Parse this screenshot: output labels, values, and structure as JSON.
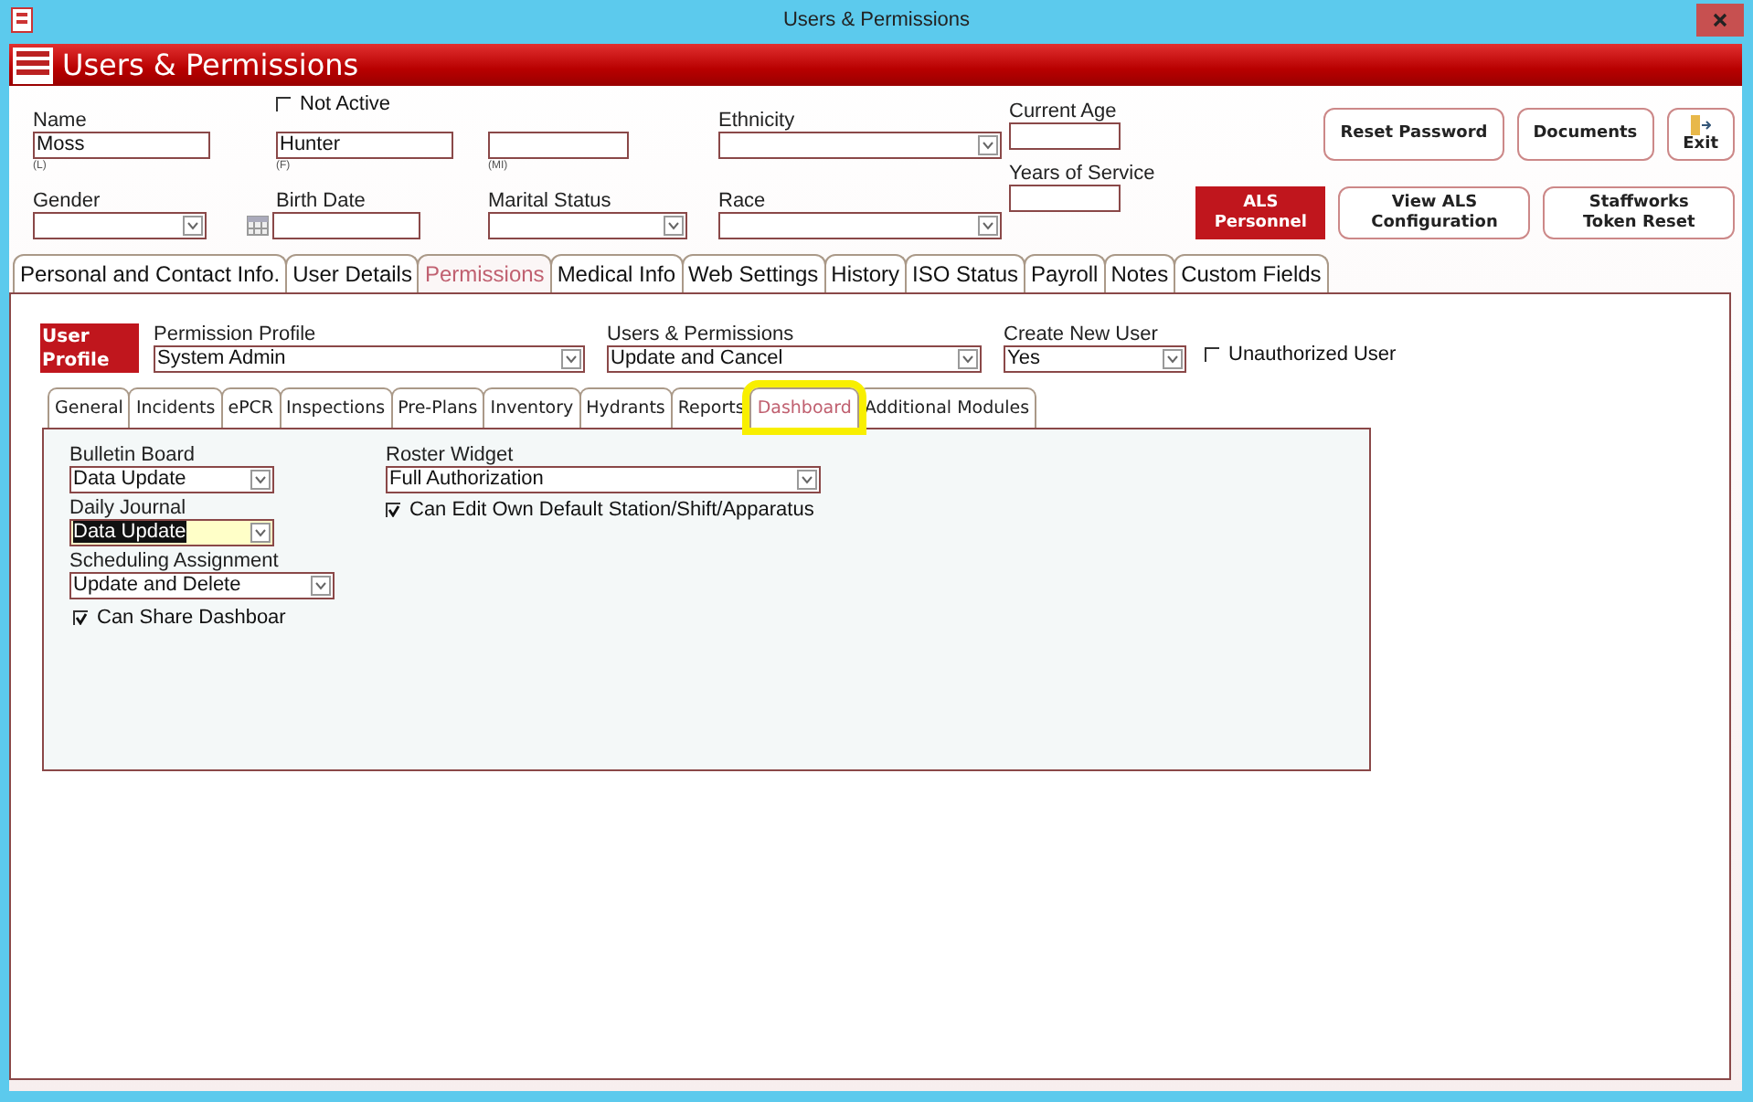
{
  "window": {
    "title": "Users & Permissions"
  },
  "header": {
    "title": "Users & Permissions"
  },
  "not_active": {
    "label": "Not Active",
    "checked": false
  },
  "name": {
    "label": "Name",
    "last": {
      "value": "Moss",
      "hint": "(L)"
    },
    "first": {
      "value": "Hunter",
      "hint": "(F)"
    },
    "middle": {
      "hint": "(MI)"
    }
  },
  "ethnicity": {
    "label": "Ethnicity"
  },
  "current_age": {
    "label": "Current Age"
  },
  "gender": {
    "label": "Gender"
  },
  "birth_date": {
    "label": "Birth Date"
  },
  "marital_status": {
    "label": "Marital Status"
  },
  "race": {
    "label": "Race"
  },
  "years_of_service": {
    "label": "Years of Service"
  },
  "top_buttons": [
    {
      "label": "Reset Password",
      "kind": "plain"
    },
    {
      "label": "Documents",
      "kind": "plain"
    },
    {
      "label": "Exit",
      "kind": "exit"
    }
  ],
  "bottom_buttons": [
    {
      "label": "ALS Personnel",
      "kind": "red"
    },
    {
      "label": "View ALS Configuration",
      "kind": "plain"
    },
    {
      "label": "Staffworks Token Reset",
      "kind": "plain"
    }
  ],
  "tabs": [
    {
      "label": "Personal and Contact Info.",
      "selected": false
    },
    {
      "label": "User Details",
      "selected": false
    },
    {
      "label": "Permissions",
      "selected": true
    },
    {
      "label": "Medical Info",
      "selected": false
    },
    {
      "label": "Web Settings",
      "selected": false
    },
    {
      "label": "History",
      "selected": false
    },
    {
      "label": "ISO Status",
      "selected": false
    },
    {
      "label": "Payroll",
      "selected": false
    },
    {
      "label": "Notes",
      "selected": false
    },
    {
      "label": "Custom Fields",
      "selected": false
    }
  ],
  "permissions": {
    "badge": "User Profile",
    "fields": [
      {
        "label": "Permission Profile",
        "value": "System Admin"
      },
      {
        "label": "Users & Permissions",
        "value": "Update and Cancel"
      },
      {
        "label": "Create New User",
        "value": "Yes"
      }
    ],
    "unauthorized": {
      "label": "Unauthorized User",
      "checked": false
    }
  },
  "subtabs": [
    {
      "label": "General",
      "selected": false,
      "highlighted": false
    },
    {
      "label": "Incidents",
      "selected": false,
      "highlighted": false
    },
    {
      "label": "ePCR",
      "selected": false,
      "highlighted": false
    },
    {
      "label": "Inspections",
      "selected": false,
      "highlighted": false
    },
    {
      "label": "Pre-Plans",
      "selected": false,
      "highlighted": false
    },
    {
      "label": "Inventory",
      "selected": false,
      "highlighted": false
    },
    {
      "label": "Hydrants",
      "selected": false,
      "highlighted": false
    },
    {
      "label": "Reports",
      "selected": false,
      "highlighted": false
    },
    {
      "label": "Dashboard",
      "selected": true,
      "highlighted": true
    },
    {
      "label": "Additional Modules",
      "selected": false,
      "highlighted": false
    }
  ],
  "dashboard": {
    "left": [
      {
        "label": "Bulletin Board",
        "value": "Data Update",
        "focused": false
      },
      {
        "label": "Daily Journal",
        "value": "Data Update",
        "focused": true
      },
      {
        "label": "Scheduling Assignment",
        "value": "Update and Delete",
        "focused": false
      }
    ],
    "share": {
      "label": "Can Share Dashboar",
      "checked": true
    },
    "roster": {
      "label": "Roster Widget",
      "value": "Full Authorization"
    },
    "edit_default": {
      "label": "Can Edit Own Default Station/Shift/Apparatus",
      "checked": true
    }
  }
}
